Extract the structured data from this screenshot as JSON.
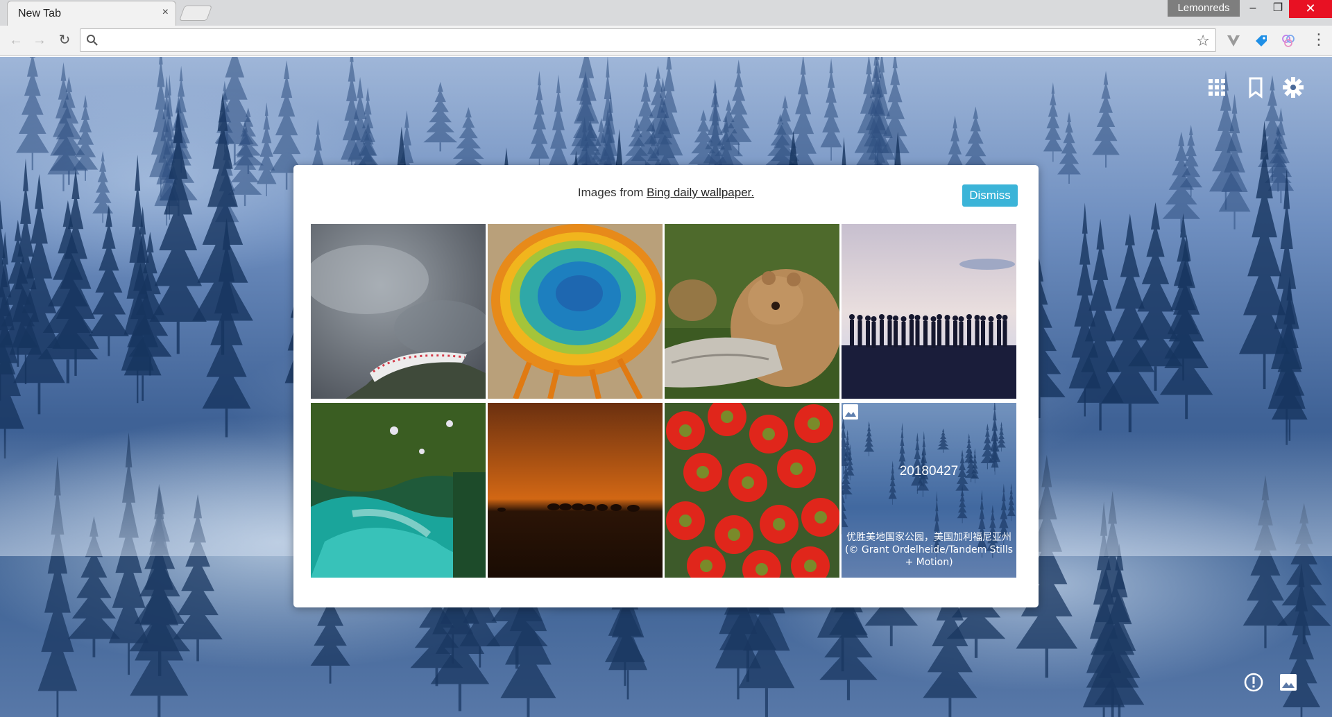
{
  "browser": {
    "tab_title": "New Tab",
    "tab_close": "×",
    "profile_name": "Lemonreds",
    "window_minimize": "–",
    "window_maximize": "❐",
    "window_close": "✕",
    "nav_back": "←",
    "nav_forward": "→",
    "nav_reload": "↻",
    "omnibox_value": "",
    "bookmark_star": "☆",
    "menu": "⋮",
    "extensions": [
      "v-icon",
      "tag-icon",
      "rings-icon"
    ]
  },
  "toolbar_icons": [
    "apps-icon",
    "bookmark-icon",
    "gear-icon"
  ],
  "bottom_icons": [
    "info-icon",
    "wallpaper-icon"
  ],
  "panel": {
    "heading_prefix": "Images from ",
    "heading_link": "Bing daily wallpaper.",
    "dismiss_label": "Dismiss",
    "wallpapers": [
      {
        "subject": "cliffside-stadium-in-clouds"
      },
      {
        "subject": "grand-prismatic-spring"
      },
      {
        "subject": "bear-cub-resting-on-log"
      },
      {
        "subject": "people-silhouettes-above-sea-of-clouds"
      },
      {
        "subject": "coastline-satellite-view"
      },
      {
        "subject": "bison-under-orange-sky"
      },
      {
        "subject": "red-cactus-flowers"
      },
      {
        "subject": "foggy-forest-current",
        "date": "20180427",
        "caption": "优胜美地国家公园，美国加利福尼亚州 (© Grant Ordelheide/Tandem Stills + Motion)"
      }
    ]
  },
  "colors": {
    "accent": "#3bb4d8",
    "close_red": "#e81123"
  }
}
